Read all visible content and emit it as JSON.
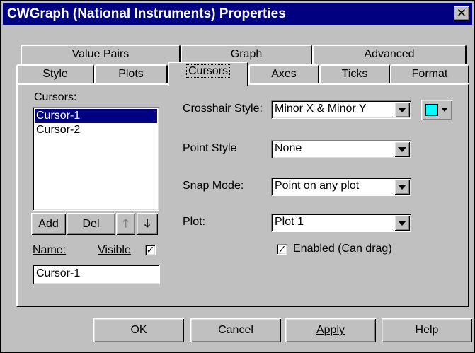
{
  "window": {
    "title": "CWGraph (National Instruments) Properties",
    "close_glyph": "✕"
  },
  "tabs_back": [
    "Value Pairs",
    "Graph",
    "Advanced"
  ],
  "tabs_front": [
    "Style",
    "Plots",
    "Cursors",
    "Axes",
    "Ticks",
    "Format"
  ],
  "cursors": {
    "list_label": "Cursors:",
    "items": [
      "Cursor-1",
      "Cursor-2"
    ],
    "selected": "Cursor-1",
    "add_label": "Add",
    "del_label": "Del",
    "up_glyph": "🡑",
    "down_glyph": "🡓",
    "name_label": "Name:",
    "name_value": "Cursor-1",
    "visible_label": "Visible",
    "visible_checked": true
  },
  "settings": {
    "crosshair_label": "Crosshair Style:",
    "crosshair_value": "Minor X & Minor Y",
    "crosshair_color": "#00ffff",
    "point_label": "Point Style",
    "point_value": "None",
    "snap_label": "Snap Mode:",
    "snap_value": "Point on any plot",
    "plot_label": "Plot:",
    "plot_value": "Plot 1",
    "enabled_label": "Enabled (Can drag)",
    "enabled_checked": true
  },
  "footer": {
    "ok": "OK",
    "cancel": "Cancel",
    "apply": "Apply",
    "help": "Help"
  },
  "colors": {
    "titlebar": "#000080",
    "face": "#c0c0c0",
    "selection": "#000080"
  }
}
